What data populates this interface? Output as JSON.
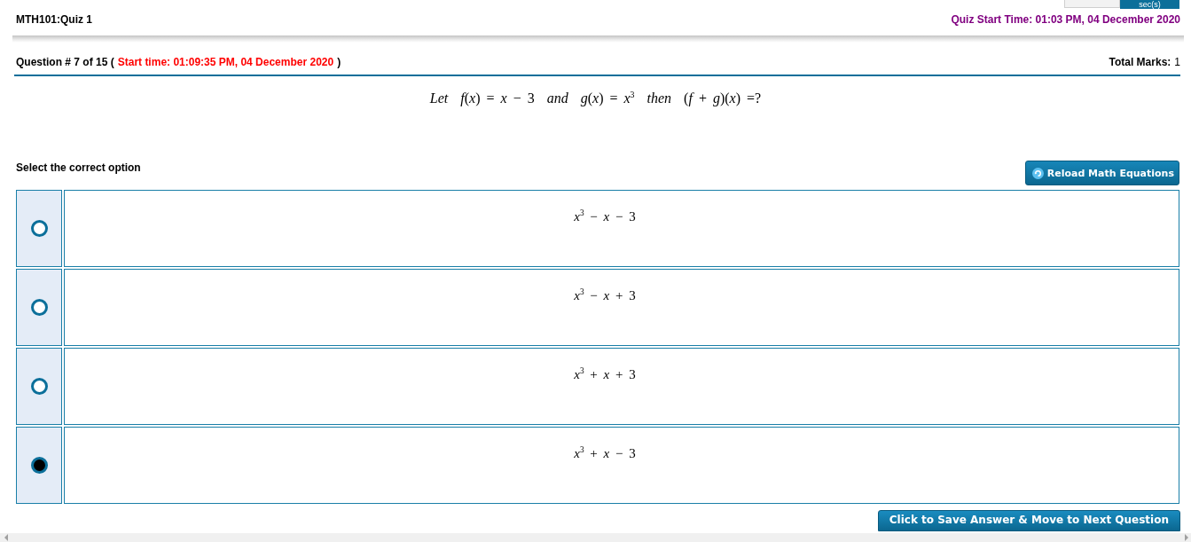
{
  "timer": {
    "unit": "sec(s)"
  },
  "header": {
    "course": "MTH101:Quiz 1",
    "quiz_start": "Quiz Start Time: 01:03 PM, 04 December 2020"
  },
  "question": {
    "number": "Question # 7 of 15 (",
    "start_time": "Start time: 01:09:35 PM, 04 December 2020",
    "close": ")",
    "total_marks_label": "Total Marks:",
    "total_marks": "1",
    "text": "*Let*  *f*(*x*) = *x* − 3  *and*  *g*(*x*) = *x*$^{3}$  *then*  (*f* + *g*)(*x*) =?"
  },
  "instruction": "Select the correct option",
  "reload_button": {
    "label": "Reload Math Equations"
  },
  "options": [
    {
      "text": "*x*$^{3}$ − *x* − 3",
      "selected": false
    },
    {
      "text": "*x*$^{3}$ − *x* + 3",
      "selected": false
    },
    {
      "text": "*x*$^{3}$ + *x* + 3",
      "selected": false
    },
    {
      "text": "*x*$^{3}$ + *x* − 3",
      "selected": true
    }
  ],
  "next_button": {
    "label": "Click to Save Answer & Move to Next Question"
  }
}
